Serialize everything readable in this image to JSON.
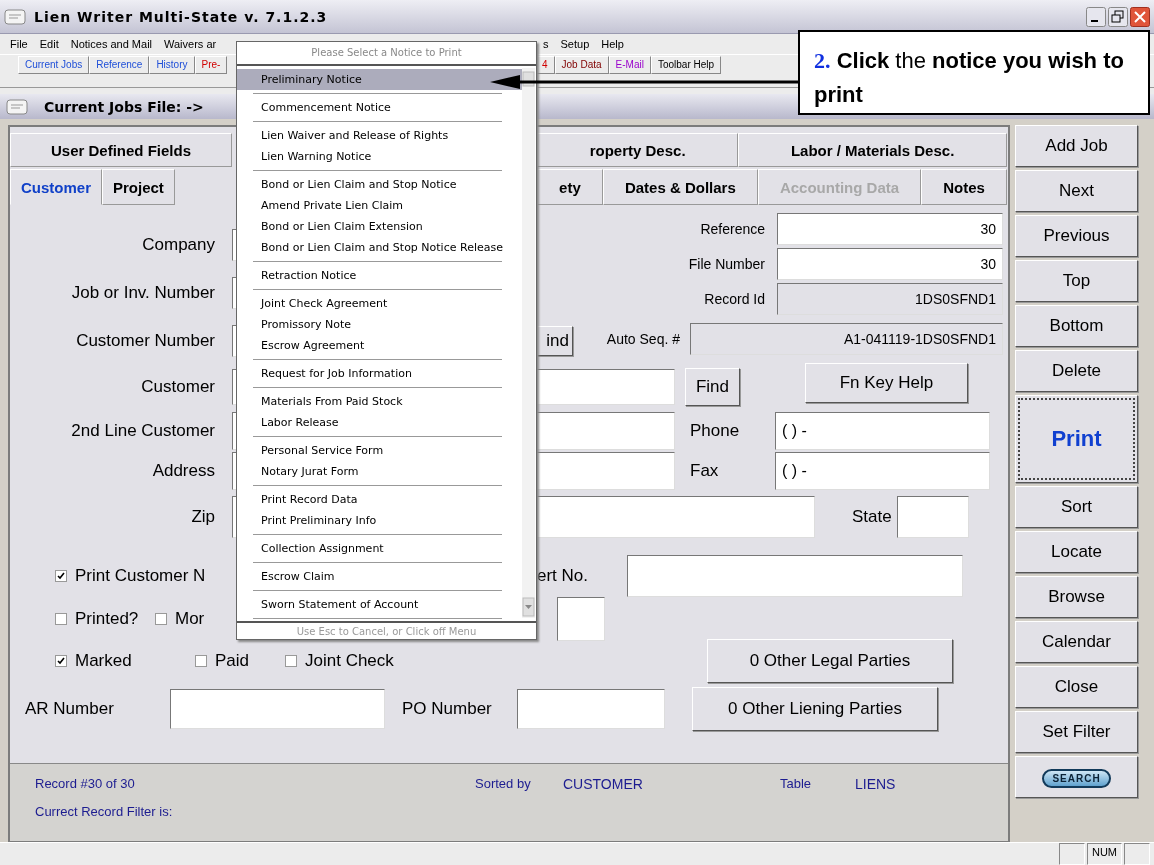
{
  "window": {
    "title": "Lien Writer Multi-State v. 7.1.2.3"
  },
  "menu_left": [
    "File",
    "Edit",
    "Notices and Mail",
    "Waivers ar"
  ],
  "menu_right": [
    "s",
    "Setup",
    "Help"
  ],
  "toolbar_left": [
    {
      "label": "Current Jobs",
      "kind": "file"
    },
    {
      "label": "Reference",
      "kind": "file"
    },
    {
      "label": "History",
      "kind": "file"
    },
    {
      "label": "Pre-",
      "kind": "notice"
    }
  ],
  "toolbar_right": [
    {
      "label": "4",
      "kind": "notice"
    },
    {
      "label": "Job Data",
      "kind": "data"
    },
    {
      "label": "E-Mail",
      "kind": "mail"
    },
    {
      "label": "Toolbar Help",
      "kind": "help"
    }
  ],
  "subwindow": {
    "title": "Current Jobs File:  ->"
  },
  "tabs_top_left": [
    {
      "label": "User Defined Fields",
      "selected": false
    }
  ],
  "tabs_top_right": [
    {
      "label": "roperty Desc.",
      "selected": false
    },
    {
      "label": "Labor / Materials Desc.",
      "selected": false
    }
  ],
  "tabs_left": [
    {
      "label": "Customer",
      "selected": true,
      "disabled": false
    },
    {
      "label": "Project",
      "selected": false,
      "disabled": false
    }
  ],
  "tabs_right": [
    {
      "label": "ety",
      "selected": false,
      "disabled": false
    },
    {
      "label": "Dates & Dollars",
      "selected": false,
      "disabled": false
    },
    {
      "label": "Accounting Data",
      "selected": false,
      "disabled": true
    },
    {
      "label": "Notes",
      "selected": false,
      "disabled": false
    }
  ],
  "form": {
    "company_label": "Company",
    "job_label": "Job or Inv. Number",
    "customer_number_label": "Customer Number",
    "find_partial": "ind",
    "reference": {
      "label": "Reference",
      "value": "30"
    },
    "file_number": {
      "label": "File Number",
      "value": "30"
    },
    "record_id": {
      "label": "Record Id",
      "value": "1DS0SFND1"
    },
    "auto_seq": {
      "label": "Auto Seq. #",
      "value": "A1-041119-1DS0SFND1"
    },
    "customer_label": "Customer",
    "find": "Find",
    "fn_key_help": "Fn Key Help",
    "line2_label": "2nd Line Customer",
    "phone": {
      "label": "Phone",
      "value": "(  )   -"
    },
    "address_label": "Address",
    "fax": {
      "label": "Fax",
      "value": "(  )   -"
    },
    "zip_label": "Zip",
    "state_label": "State",
    "cert_label": "ert No.",
    "checkboxes": [
      {
        "label": "Print Customer N",
        "checked": true
      },
      {
        "label": "Printed?",
        "checked": false
      },
      {
        "label": "Mor",
        "checked": false
      },
      {
        "label": "Marked",
        "checked": true
      },
      {
        "label": "Paid",
        "checked": false
      },
      {
        "label": "Joint Check",
        "checked": false
      }
    ],
    "other_legal": "0 Other Legal Parties",
    "other_liening": "0 Other Liening Parties",
    "ar_label": "AR Number",
    "po_label": "PO Number"
  },
  "status": {
    "record": "Record #30 of 30",
    "sorted_label": "Sorted by",
    "sorted_value": "CUSTOMER",
    "table_label": "Table",
    "table_value": "LIENS",
    "filter": "Currect Record Filter is:"
  },
  "side_buttons": [
    {
      "label": "Add Job",
      "kind": "normal"
    },
    {
      "label": "Next",
      "kind": "normal"
    },
    {
      "label": "Previous",
      "kind": "normal"
    },
    {
      "label": "Top",
      "kind": "normal"
    },
    {
      "label": "Bottom",
      "kind": "normal"
    },
    {
      "label": "Delete",
      "kind": "normal"
    },
    {
      "label": "Print",
      "kind": "primary"
    },
    {
      "label": "Sort",
      "kind": "normal"
    },
    {
      "label": "Locate",
      "kind": "normal"
    },
    {
      "label": "Browse",
      "kind": "normal"
    },
    {
      "label": "Calendar",
      "kind": "normal"
    },
    {
      "label": "Close",
      "kind": "normal"
    },
    {
      "label": "Set Filter",
      "kind": "normal"
    },
    {
      "label": "SEARCH",
      "kind": "search"
    }
  ],
  "status_bar": [
    "NUM"
  ],
  "popup": {
    "title": "Please Select a Notice to Print",
    "footer": "Use Esc to Cancel, or Click off Menu",
    "groups": [
      {
        "items": [
          {
            "label": "Preliminary Notice",
            "selected": true
          }
        ]
      },
      {
        "items": [
          {
            "label": "Commencement Notice",
            "selected": false
          }
        ]
      },
      {
        "items": [
          {
            "label": "Lien Waiver and Release of Rights",
            "selected": false
          },
          {
            "label": "Lien Warning Notice",
            "selected": false
          }
        ]
      },
      {
        "items": [
          {
            "label": "Bond or Lien Claim and Stop Notice",
            "selected": false
          },
          {
            "label": "Amend Private Lien Claim",
            "selected": false
          },
          {
            "label": "Bond or Lien Claim Extension",
            "selected": false
          },
          {
            "label": "Bond or Lien Claim and Stop Notice Release",
            "selected": false
          }
        ]
      },
      {
        "items": [
          {
            "label": "Retraction Notice",
            "selected": false
          }
        ]
      },
      {
        "items": [
          {
            "label": "Joint Check Agreement",
            "selected": false
          },
          {
            "label": "Promissory Note",
            "selected": false
          },
          {
            "label": "Escrow Agreement",
            "selected": false
          }
        ]
      },
      {
        "items": [
          {
            "label": "Request for Job Information",
            "selected": false
          }
        ]
      },
      {
        "items": [
          {
            "label": "Materials From Paid Stock",
            "selected": false
          },
          {
            "label": "Labor Release",
            "selected": false
          }
        ]
      },
      {
        "items": [
          {
            "label": "Personal Service Form",
            "selected": false
          },
          {
            "label": "Notary Jurat Form",
            "selected": false
          }
        ]
      },
      {
        "items": [
          {
            "label": "Print Record Data",
            "selected": false
          },
          {
            "label": "Print Preliminary Info",
            "selected": false
          }
        ]
      },
      {
        "items": [
          {
            "label": "Collection Assignment",
            "selected": false
          }
        ]
      },
      {
        "items": [
          {
            "label": "Escrow Claim",
            "selected": false
          }
        ]
      },
      {
        "items": [
          {
            "label": "Sworn Statement of Account",
            "selected": false
          }
        ]
      }
    ]
  },
  "callout": {
    "step": "2.",
    "text": "**Click** the **notice you wish to print**"
  }
}
